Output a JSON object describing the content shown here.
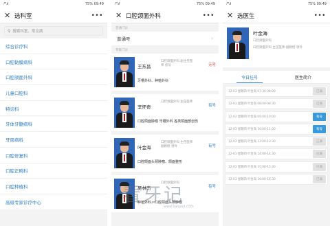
{
  "status_bar": {
    "signal": "ᵢ⁴ᴳ.ıl",
    "battery": "75%",
    "time": "09:49"
  },
  "panel1": {
    "title": "选科室",
    "search_placeholder": "搜索科室、常见病",
    "departments": [
      "综合诊疗科",
      "口腔黏膜病科",
      "口腔颌面外科",
      "儿童口腔科",
      "特诊科",
      "牙体牙髓病科",
      "牙周病科",
      "口腔修复科",
      "口腔正畸科",
      "口腔种植科",
      "高级专家诊疗中心"
    ]
  },
  "panel2": {
    "title": "口腔颌面外科",
    "general_section": "普通门诊",
    "general_item": "普通号",
    "expert_section": "专家门诊",
    "doctors": [
      {
        "name": "王东昌",
        "title": "口腔颌面外科  副主任医师  初号",
        "spec": "牙槽外科、种植外科",
        "status": "无号"
      },
      {
        "name": "李怀奇",
        "title": "口腔颌面外科  主任医师",
        "spec": "口腔颌面肿瘤 牙槽外科 各类颌面部创伤",
        "status": "有号"
      },
      {
        "name": "叶金海",
        "title": "口腔颌面外科  主任医师  副教授  领导",
        "spec": "口腔颌面头颈肿瘤、颌面整形",
        "status": "有号"
      },
      {
        "name": "吴林杰",
        "title": "口腔颌面外科",
        "spec": "种植外科、口腔颌面头颈肿瘤",
        "status": "有号"
      }
    ]
  },
  "panel3": {
    "title": "选医生",
    "doctor_name": "叶金海",
    "doctor_line1": "口腔颌面外科",
    "doctor_line2": "口腔颌面外科 主任医师 副教授 领导",
    "tab_schedule": "今日挂号",
    "tab_profile": "医生简介",
    "slots": [
      {
        "text": "12-03 星期四 叶金海 07:30-08:00",
        "btn": "已满",
        "available": false
      },
      {
        "text": "12-03 星期四 叶金海 08:00-08:30",
        "btn": "已满",
        "available": false
      },
      {
        "text": "12-03 星期四 叶金海 09:00-10:00",
        "btn": "有号",
        "available": true
      },
      {
        "text": "12-03 星期四 叶金海 10:00-11:00",
        "btn": "有号",
        "available": true
      },
      {
        "text": "12-03 星期四 叶金海 13:00-13:30",
        "btn": "已满",
        "available": false
      },
      {
        "text": "12-03 星期四 叶金海 14:00-14:30",
        "btn": "已满",
        "available": false
      },
      {
        "text": "12-03 星期四 叶金海 15:00-15:30",
        "btn": "已满",
        "available": false
      },
      {
        "text": "12-03 星期四 叶金海 16:00-16:30",
        "btn": "已满",
        "available": false
      }
    ]
  },
  "watermark": {
    "main": "看牙记",
    "sub": "www.kanyaji.com"
  },
  "colors": {
    "accent": "#2f80c8",
    "unavailable": "#e74c3c",
    "slot_available": "#3a9ad9"
  }
}
